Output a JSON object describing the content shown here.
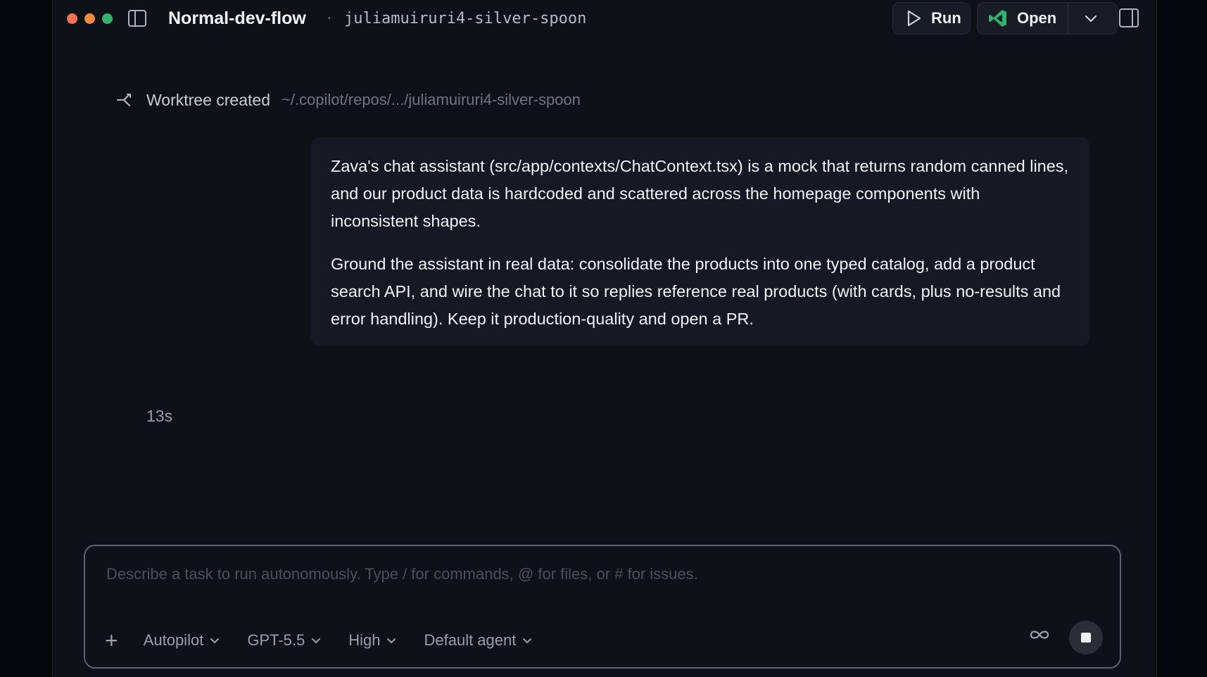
{
  "titlebar": {
    "title": "Normal-dev-flow",
    "separator": "·",
    "branch": "juliamuiruri4-silver-spoon",
    "run_label": "Run",
    "open_label": "Open"
  },
  "worktree": {
    "label": "Worktree created",
    "path": "~/.copilot/repos/.../juliamuiruri4-silver-spoon"
  },
  "message": {
    "paragraphs": [
      "Zava's chat assistant (src/app/contexts/ChatContext.tsx) is a mock that returns random canned lines, and our product data is hardcoded and scattered across the homepage components with inconsistent shapes.",
      "Ground the assistant in real data: consolidate the products into one typed catalog, add a product search API, and wire the chat to it so replies reference real products (with cards, plus no-results and error handling). Keep it production-quality and open a PR."
    ]
  },
  "status": {
    "elapsed": "13s"
  },
  "composer": {
    "placeholder": "Describe a task to run autonomously. Type / for commands, @ for files, or # for issues.",
    "value": "",
    "mode": "Autopilot",
    "model": "GPT-5.5",
    "effort": "High",
    "agent": "Default agent"
  },
  "icons": {
    "run": "play-icon",
    "open": "vscode-icon",
    "worktree": "branch-icon",
    "infinity": "infinity-icon",
    "stop": "stop-icon"
  },
  "colors": {
    "accent_vscode": "#2fb66e",
    "background": "#0d1118"
  }
}
